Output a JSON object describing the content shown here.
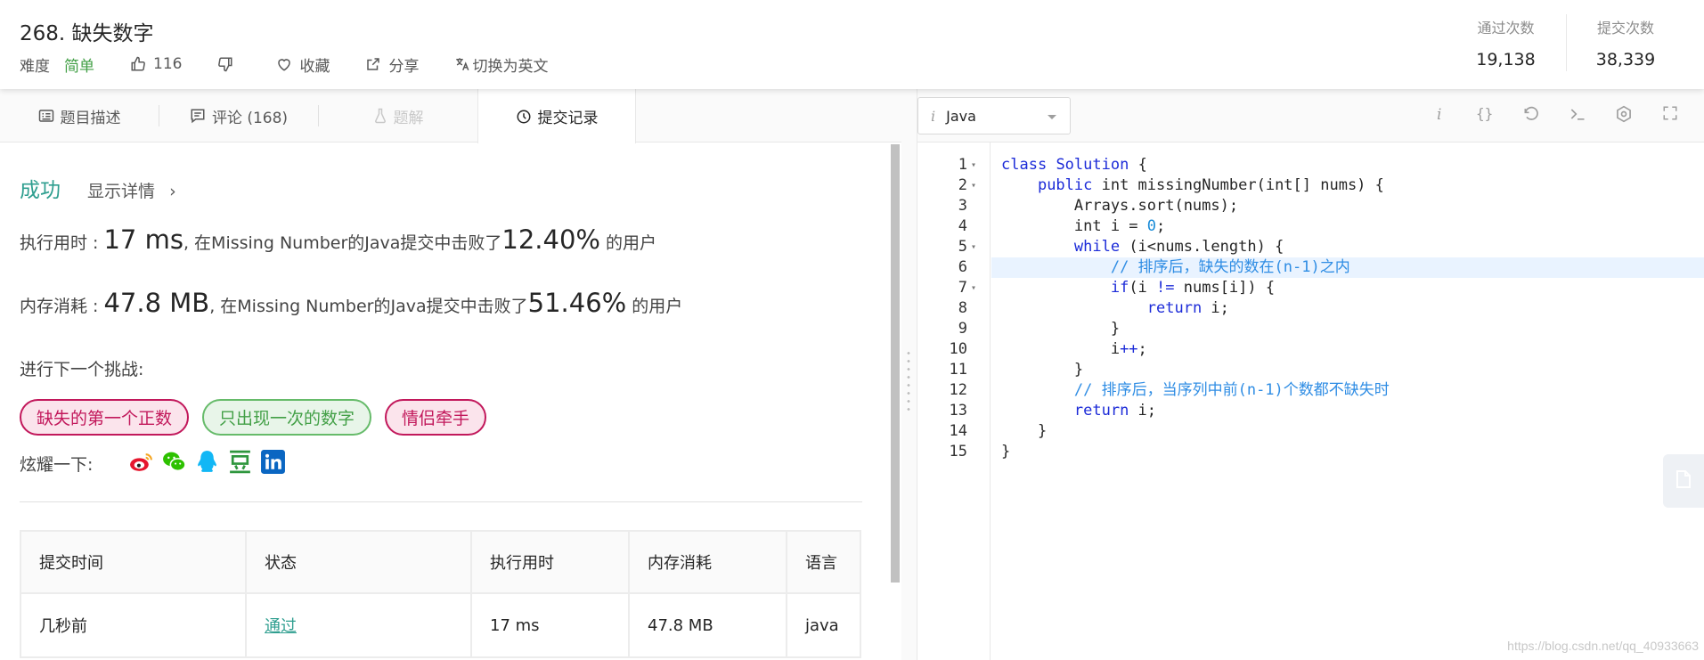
{
  "header": {
    "title": "268. 缺失数字",
    "difficulty_label": "难度",
    "difficulty_value": "简单",
    "likes": "116",
    "favorite_label": "收藏",
    "share_label": "分享",
    "switch_lang_label": "切换为英文",
    "accepted_label": "通过次数",
    "accepted_value": "19,138",
    "submissions_label": "提交次数",
    "submissions_value": "38,339"
  },
  "tabs": [
    {
      "label": "题目描述",
      "icon": "description-icon"
    },
    {
      "label": "评论 (168)",
      "icon": "comment-icon"
    },
    {
      "label": "题解",
      "icon": "flask-icon",
      "disabled": true
    },
    {
      "label": "提交记录",
      "icon": "clock-icon",
      "active": true
    }
  ],
  "result": {
    "status": "成功",
    "details_label": "显示详情",
    "runtime_label": "执行用时 : ",
    "runtime_value": "17 ms",
    "runtime_mid": ", 在Missing Number的Java提交中击败了",
    "runtime_percent": "12.40%",
    "runtime_suffix": " 的用户",
    "memory_label": "内存消耗 : ",
    "memory_value": "47.8 MB",
    "memory_mid": ", 在Missing Number的Java提交中击败了",
    "memory_percent": "51.46%",
    "memory_suffix": " 的用户",
    "next_label": "进行下一个挑战:",
    "tags": [
      "缺失的第一个正数",
      "只出现一次的数字",
      "情侣牵手"
    ],
    "share_label": "炫耀一下:",
    "share_icons": [
      "weibo-icon",
      "wechat-icon",
      "qq-icon",
      "douban-icon",
      "linkedin-icon"
    ]
  },
  "table": {
    "headers": [
      "提交时间",
      "状态",
      "执行用时",
      "内存消耗",
      "语言"
    ],
    "rows": [
      [
        "几秒前",
        "通过",
        "17 ms",
        "47.8 MB",
        "java"
      ]
    ]
  },
  "editor": {
    "language": "Java",
    "toolbar_icons": [
      "info-icon",
      "braces-icon",
      "reset-icon",
      "console-icon",
      "settings-icon",
      "fullscreen-icon"
    ],
    "highlighted_line": 6
  },
  "colors": {
    "success": "#2e9e8f",
    "easy": "#43a047",
    "tag_pink": "#c2185b",
    "tag_green": "#43a047",
    "keyword": "#1c2bd8",
    "comment": "#2f8de4"
  },
  "watermark": "https://blog.csdn.net/qq_40933663"
}
